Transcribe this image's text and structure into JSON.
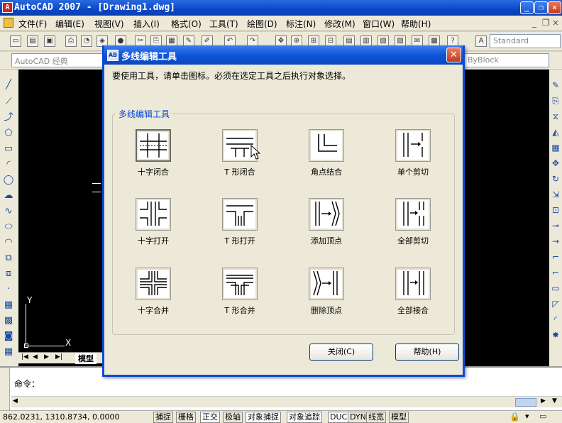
{
  "app": {
    "title": "AutoCAD 2007 - [Drawing1.dwg]"
  },
  "menu": [
    "文件(F)",
    "编辑(E)",
    "视图(V)",
    "插入(I)",
    "格式(O)",
    "工具(T)",
    "绘图(D)",
    "标注(N)",
    "修改(M)",
    "窗口(W)",
    "帮助(H)"
  ],
  "toolbar": {
    "workspace": "AutoCAD 经典",
    "text_style": "Standard",
    "lineweight": "ByBlock"
  },
  "dialog": {
    "title": "多线编辑工具",
    "instruction": "要使用工具，请单击图标。必须在选定工具之后执行对象选择。",
    "group_label": "多线编辑工具",
    "tools": [
      {
        "label": "十字闭合",
        "icon": "cross-closed-icon"
      },
      {
        "label": "T 形闭合",
        "icon": "tee-closed-icon"
      },
      {
        "label": "角点结合",
        "icon": "corner-joint-icon"
      },
      {
        "label": "单个剪切",
        "icon": "cut-single-icon"
      },
      {
        "label": "十字打开",
        "icon": "cross-open-icon"
      },
      {
        "label": "T 形打开",
        "icon": "tee-open-icon"
      },
      {
        "label": "添加顶点",
        "icon": "add-vertex-icon"
      },
      {
        "label": "全部剪切",
        "icon": "cut-all-icon"
      },
      {
        "label": "十字合并",
        "icon": "cross-merged-icon"
      },
      {
        "label": "T 形合并",
        "icon": "tee-merged-icon"
      },
      {
        "label": "删除顶点",
        "icon": "delete-vertex-icon"
      },
      {
        "label": "全部接合",
        "icon": "weld-all-icon"
      }
    ],
    "close_label": "关闭(C)",
    "help_label": "帮助(H)"
  },
  "drawing": {
    "tab_model": "模型",
    "axis_x": "X",
    "axis_y": "Y"
  },
  "command": {
    "prompt": "命令："
  },
  "status": {
    "coords": "862.0231,  1310.8734, 0.0000",
    "toggles": [
      "捕捉",
      "栅格",
      "正交",
      "极轴",
      "对象捕捉",
      "对象追踪",
      "DUCS",
      "DYN",
      "线宽",
      "模型"
    ]
  }
}
